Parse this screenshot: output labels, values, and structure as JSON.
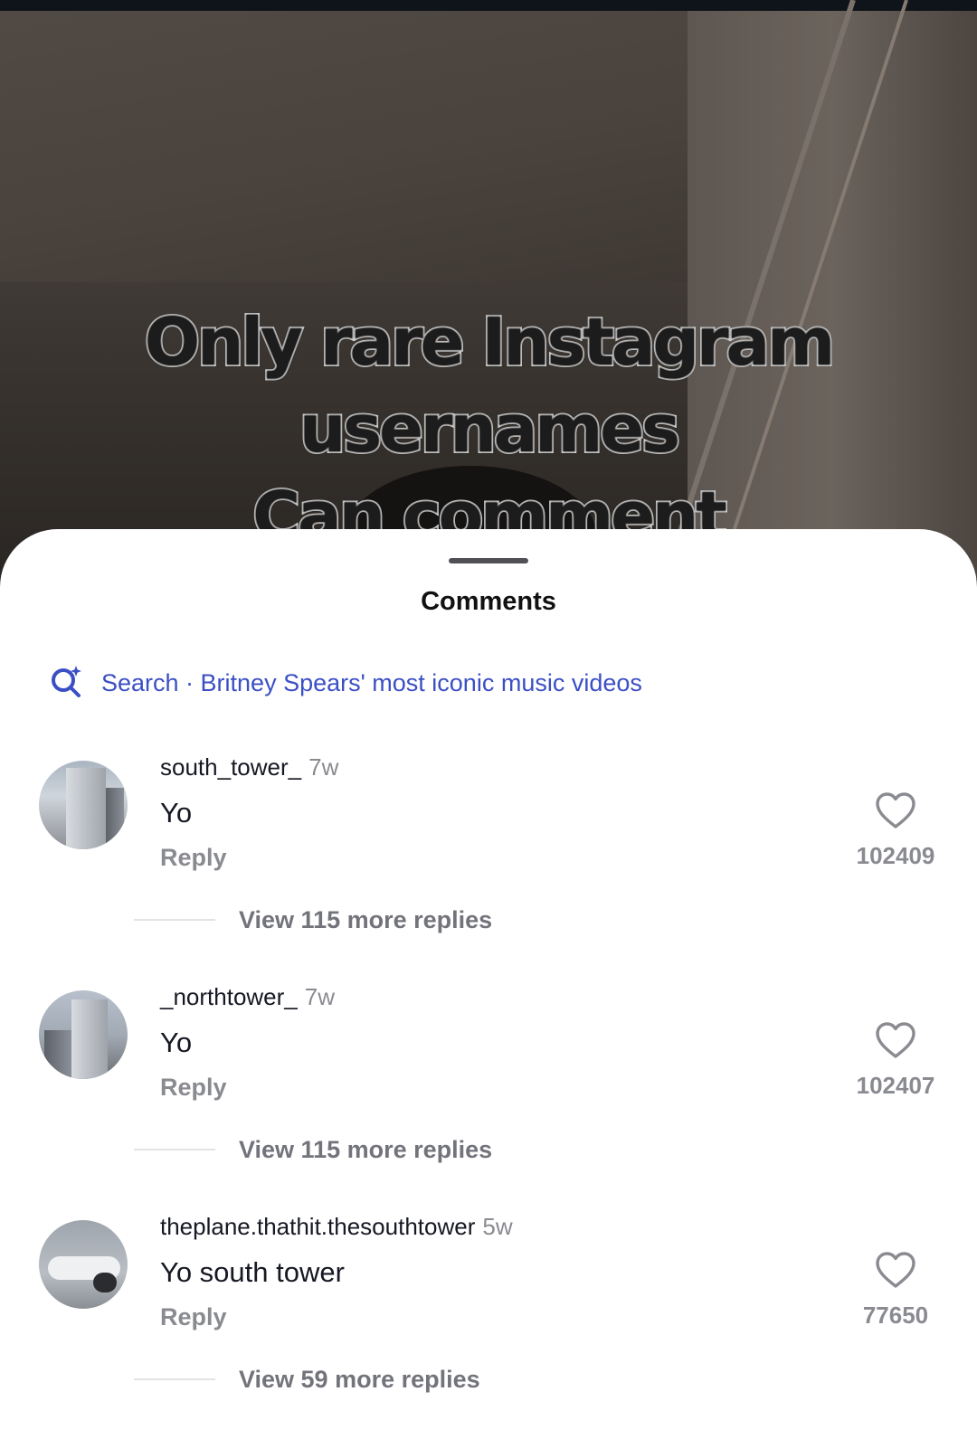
{
  "video": {
    "caption_line1": "Only rare Instagram usernames",
    "caption_line2": "Can comment"
  },
  "sheet": {
    "title": "Comments",
    "search": {
      "icon": "search-sparkle-icon",
      "text": "Search · Britney Spears' most iconic music videos",
      "color": "#3b4fc4"
    }
  },
  "comments": [
    {
      "username": "south_tower_",
      "time": "7w",
      "text": "Yo",
      "reply_label": "Reply",
      "likes": "102409",
      "view_more": "View 115 more replies"
    },
    {
      "username": "_northtower_",
      "time": "7w",
      "text": "Yo",
      "reply_label": "Reply",
      "likes": "102407",
      "view_more": "View 115 more replies"
    },
    {
      "username": "theplane.thathit.thesouthtower",
      "time": "5w",
      "text": "Yo south tower",
      "reply_label": "Reply",
      "likes": "77650",
      "view_more": "View 59 more replies"
    }
  ]
}
